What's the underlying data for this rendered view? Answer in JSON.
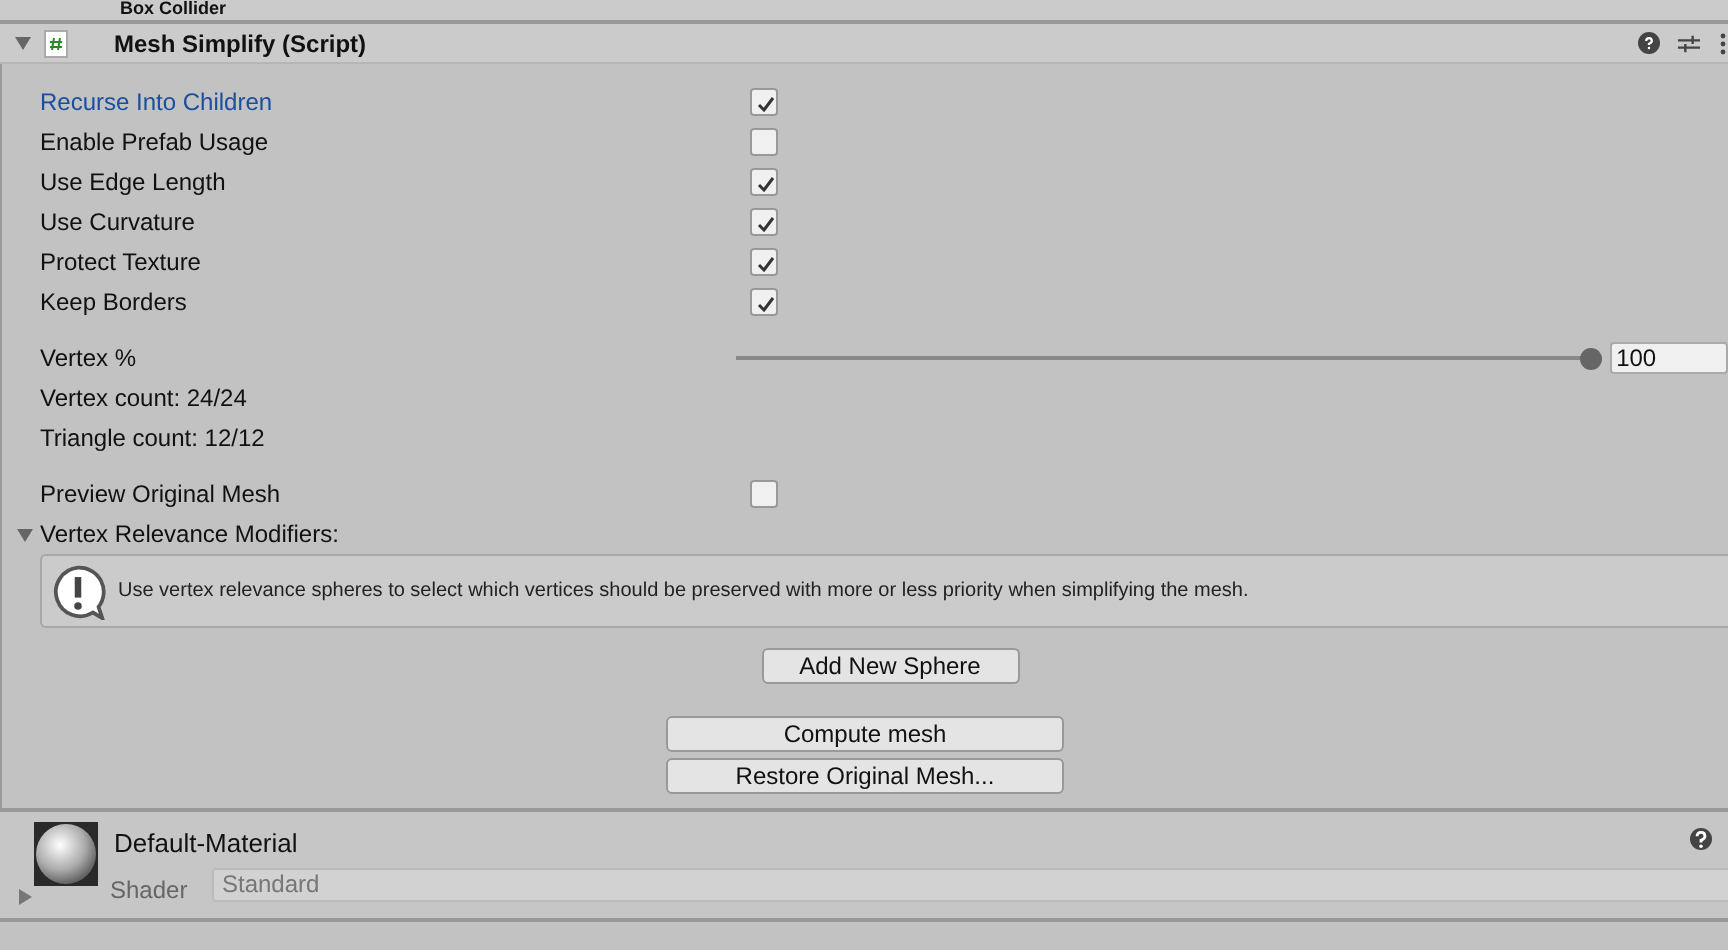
{
  "previous_component": {
    "title": "Box Collider"
  },
  "component": {
    "title": "Mesh Simplify (Script)",
    "expanded": true
  },
  "toggles": [
    {
      "label": "Recurse Into Children",
      "checked": true,
      "selected": true
    },
    {
      "label": "Enable Prefab Usage",
      "checked": false,
      "selected": false
    },
    {
      "label": "Use Edge Length",
      "checked": true,
      "selected": false
    },
    {
      "label": "Use Curvature",
      "checked": true,
      "selected": false
    },
    {
      "label": "Protect Texture",
      "checked": true,
      "selected": false
    },
    {
      "label": "Keep Borders",
      "checked": true,
      "selected": false
    }
  ],
  "vertex_percent": {
    "label": "Vertex %",
    "level": 1,
    "value": "100"
  },
  "stats": [
    "Vertex count: 24/24",
    "Triangle count: 12/12"
  ],
  "preview": {
    "label": "Preview Original Mesh",
    "checked": false
  },
  "modifiers": {
    "label": "Vertex Relevance Modifiers:",
    "expanded": true,
    "help": "Use vertex relevance spheres to select which vertices should be preserved with more or less priority when simplifying the mesh.",
    "button": "Add New Sphere"
  },
  "actions": [
    "Compute mesh",
    "Restore Original Mesh..."
  ],
  "material": {
    "name": "Default-Material",
    "shader_label": "Shader",
    "shader": "Standard"
  }
}
